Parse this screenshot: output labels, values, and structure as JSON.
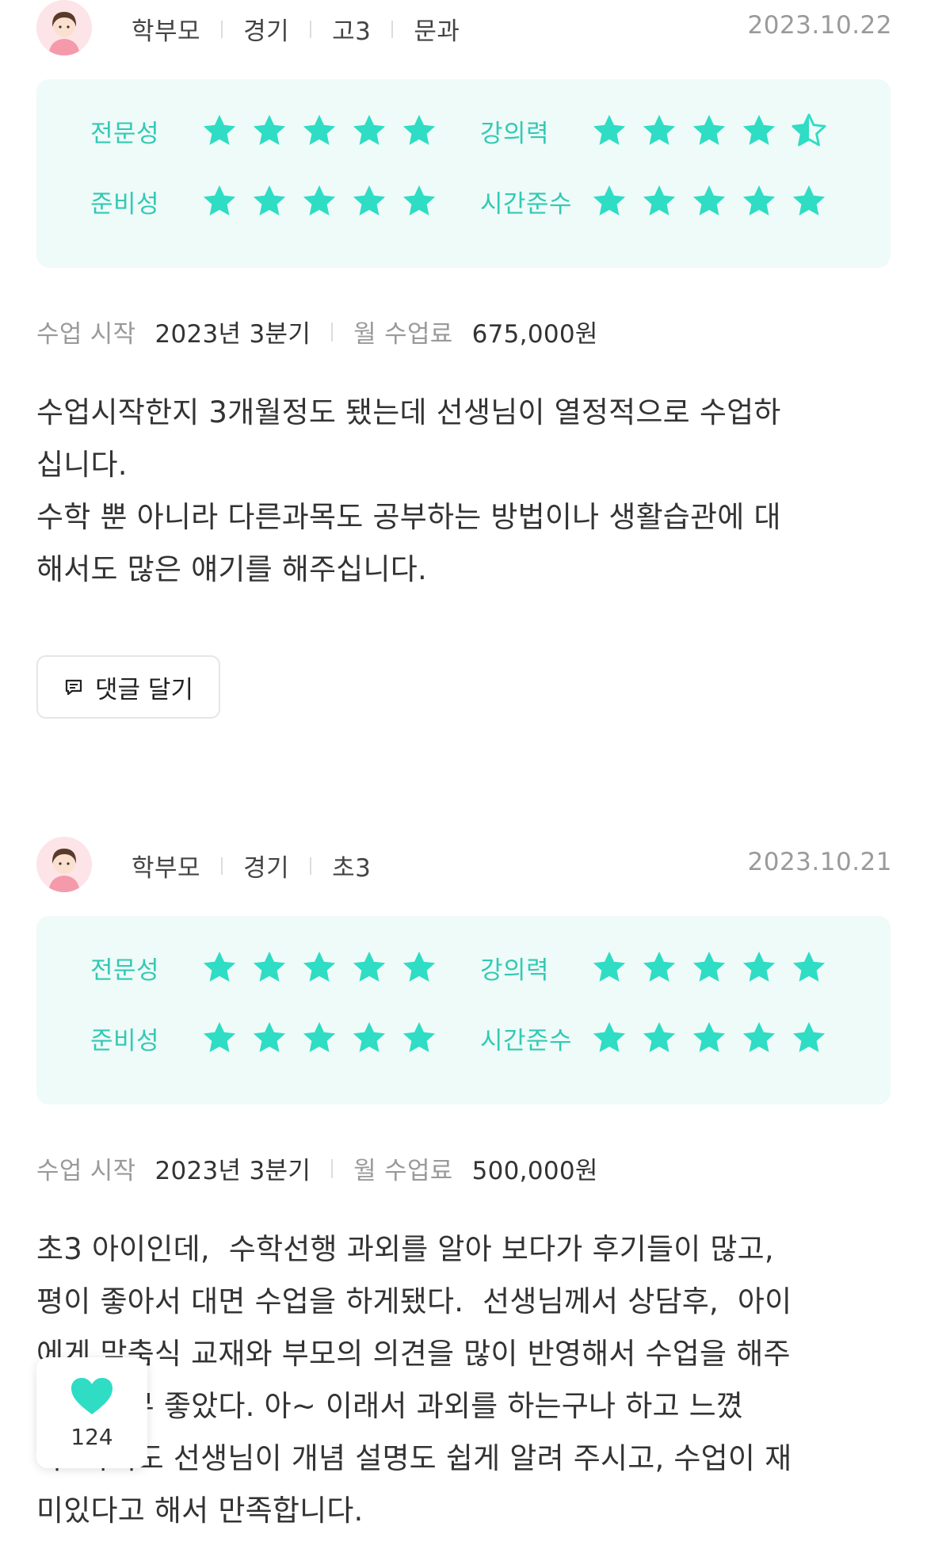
{
  "reviews": [
    {
      "author": {
        "role": "학부모",
        "region": "경기",
        "grade": "고3",
        "track": "문과"
      },
      "date": "2023.10.22",
      "ratings": {
        "expertise": {
          "label": "전문성",
          "value": 5
        },
        "lecture": {
          "label": "강의력",
          "value": 4.5
        },
        "preparation": {
          "label": "준비성",
          "value": 5
        },
        "punctuality": {
          "label": "시간준수",
          "value": 5
        }
      },
      "info": {
        "start_label": "수업 시작",
        "start_value": "2023년 3분기",
        "fee_label": "월 수업료",
        "fee_value": "675,000원"
      },
      "text": "수업시작한지 3개월정도 됐는데 선생님이 열정적으로 수업하\n십니다.\n수학 뿐 아니라 다른과목도 공부하는 방법이나 생활습관에 대\n해서도 많은 얘기를 해주십니다.",
      "comment_button": "댓글 달기"
    },
    {
      "author": {
        "role": "학부모",
        "region": "경기",
        "grade": "초3"
      },
      "date": "2023.10.21",
      "ratings": {
        "expertise": {
          "label": "전문성",
          "value": 5
        },
        "lecture": {
          "label": "강의력",
          "value": 5
        },
        "preparation": {
          "label": "준비성",
          "value": 5
        },
        "punctuality": {
          "label": "시간준수",
          "value": 5
        }
      },
      "info": {
        "start_label": "수업 시작",
        "start_value": "2023년 3분기",
        "fee_label": "월 수업료",
        "fee_value": "500,000원"
      },
      "text": "초3 아이인데,  수학선행 과외를 알아 보다가 후기들이 많고,\n평이 좋아서 대면 수업을 하게됐다.  선생님께서 상담후,  아이\n에게 맞춤식 교재와 부모의 의견을 많이 반영해서 수업을 해주\n셔서 너무 좋았다. 아~ 이래서 과외를 하는구나 하고 느꼈\n다. 아이도 선생님이 개념 설명도 쉽게 알려 주시고, 수업이 재\n미있다고 해서 만족합니다."
    }
  ],
  "like": {
    "count": "124",
    "icon": "heart-icon"
  },
  "colors": {
    "accent": "#2fdcc4",
    "label": "#33c9b4",
    "box_bg": "#eefbf8"
  }
}
